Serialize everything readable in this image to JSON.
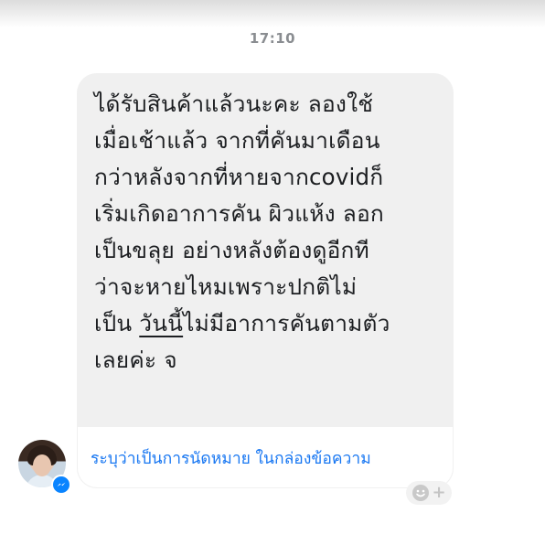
{
  "timestamp": "17:10",
  "message": {
    "lines": [
      "ได้รับสินค้าแล้วนะคะ ลองใช้",
      "เมื่อเช้าแล้ว จากที่คันมาเดือน",
      "กว่าหลังจากที่หายจากcovidก็",
      "เริ่มเกิดอาการคัน ผิวแห้ง ลอก",
      "เป็นขลุย อย่างหลังต้องดูอีกที",
      "ว่าจะหายไหมเพราะปกติไม่"
    ],
    "line7_prefix": "เป็น ",
    "line7_underlined": "วันนี้",
    "line7_suffix": "ไม่มีอาการคันตามตัว",
    "line8": "เลยค่ะ จ"
  },
  "action_bar": {
    "link_text": "ระบุว่าเป็นการนัดหมาย ในกล่องข้อความ"
  },
  "icons": {
    "avatar": "profile-photo",
    "badge": "messenger-icon",
    "react": "add-reaction-icon"
  },
  "colors": {
    "bubble": "#f0f0f0",
    "link": "#1877f2",
    "timestamp": "#8a8d91",
    "badge": "#0a84ff"
  }
}
